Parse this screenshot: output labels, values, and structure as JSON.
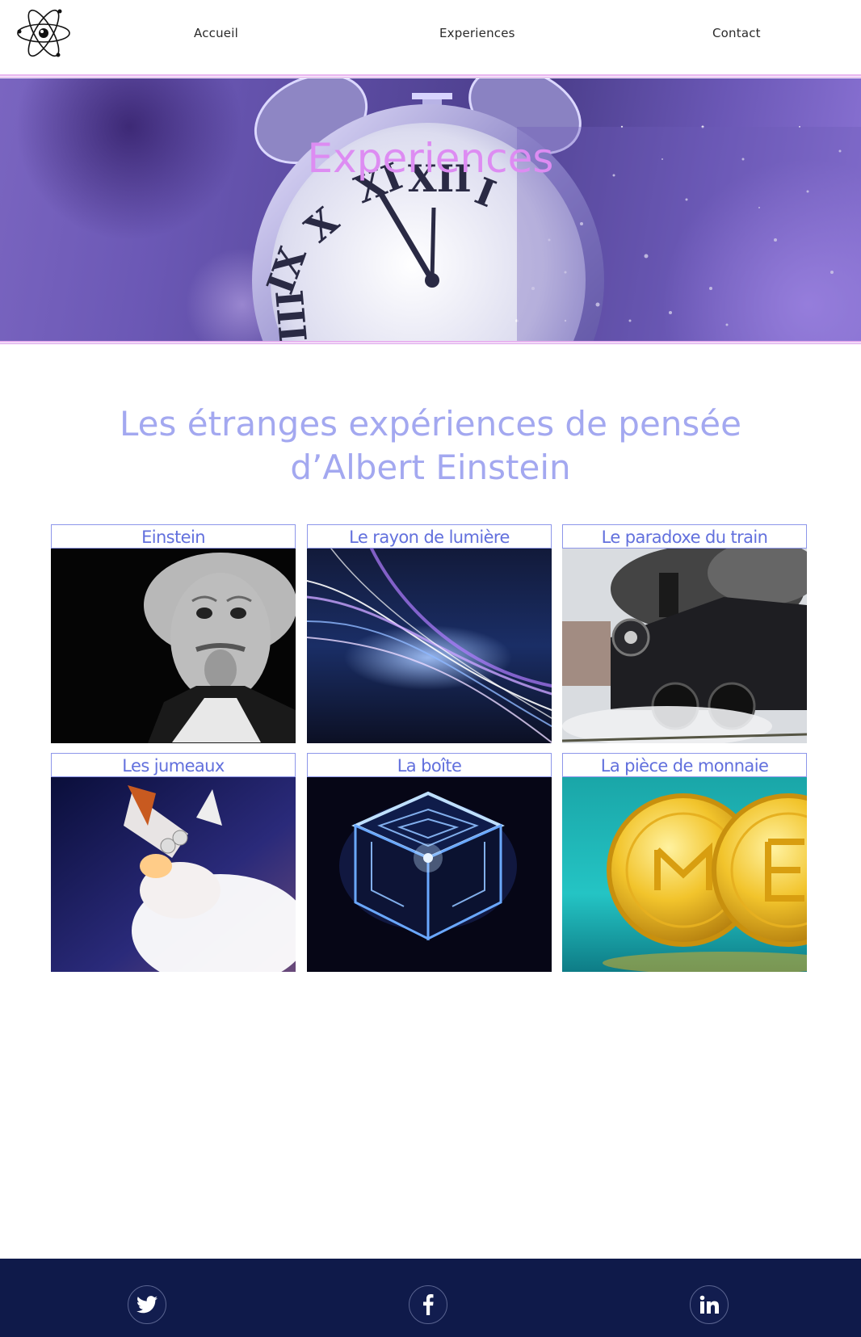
{
  "header": {
    "logo_name": "atom-logo",
    "nav": [
      {
        "label": "Accueil"
      },
      {
        "label": "Experiences"
      },
      {
        "label": "Contact"
      }
    ]
  },
  "hero": {
    "title": "Experiences",
    "background": "clock-dissolving-image"
  },
  "main": {
    "heading": "Les étranges expériences de pensée d’Albert Einstein",
    "cards": [
      {
        "label": "Einstein",
        "image": "einstein-tongue-photo"
      },
      {
        "label": "Le rayon de lumière",
        "image": "light-ray-image"
      },
      {
        "label": "Le paradoxe du train",
        "image": "steam-train-photo"
      },
      {
        "label": "Les jumeaux",
        "image": "space-shuttle-photo"
      },
      {
        "label": "La boîte",
        "image": "glowing-cube-image"
      },
      {
        "label": "La pièce de monnaie",
        "image": "gold-coins-image"
      }
    ]
  },
  "footer": {
    "social": [
      {
        "icon": "twitter-icon"
      },
      {
        "icon": "facebook-icon"
      },
      {
        "icon": "linkedin-icon"
      }
    ]
  },
  "colors": {
    "accent_pink": "#dd8cf2",
    "heading_lavender": "#a3a8f0",
    "card_label": "#6270dd",
    "footer_bg": "#0f1a4a"
  }
}
